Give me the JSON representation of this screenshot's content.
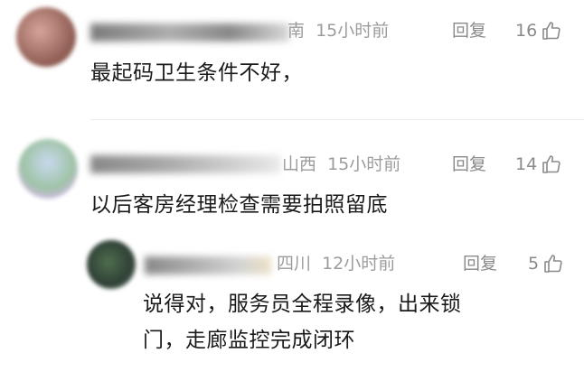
{
  "comments": [
    {
      "location": "南",
      "time": "15小时前",
      "reply_label": "回复",
      "likes": "16",
      "text": "最起码卫生条件不好，"
    },
    {
      "location": "山西",
      "time": "15小时前",
      "reply_label": "回复",
      "likes": "14",
      "text": "以后客房经理检查需要拍照留底"
    },
    {
      "location": "四川",
      "time": "12小时前",
      "reply_label": "回复",
      "likes": "5",
      "text_line1": "说得对，服务员全程录像，出来锁",
      "text_line2": "门，走廊监控完成闭环"
    }
  ],
  "icons": {
    "like": "thumbs-up-icon",
    "avatar": "blurred-avatar"
  }
}
